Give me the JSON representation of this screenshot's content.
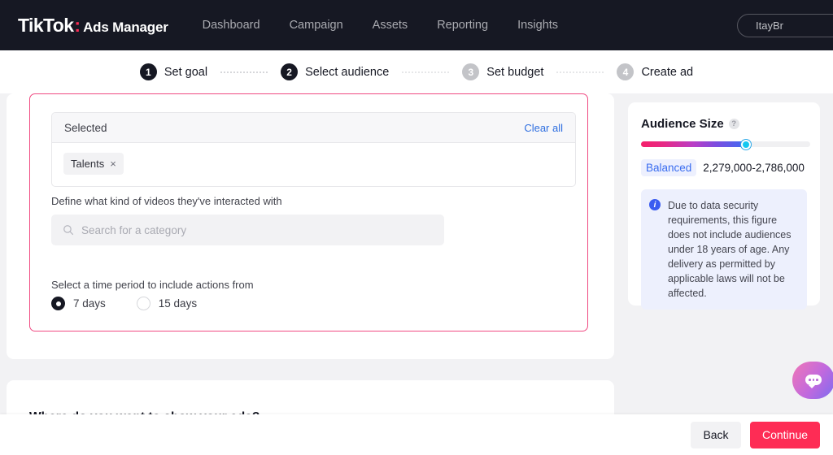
{
  "header": {
    "brand_primary": "TikTok",
    "brand_colon": ":",
    "brand_secondary": "Ads Manager",
    "nav_items": [
      {
        "label": "Dashboard"
      },
      {
        "label": "Campaign"
      },
      {
        "label": "Assets"
      },
      {
        "label": "Reporting"
      },
      {
        "label": "Insights"
      }
    ],
    "account_name": "ItayBr"
  },
  "steps": [
    {
      "number": "1",
      "label": "Set goal",
      "state": "active"
    },
    {
      "number": "2",
      "label": "Select audience",
      "state": "active"
    },
    {
      "number": "3",
      "label": "Set budget",
      "state": "inactive"
    },
    {
      "number": "4",
      "label": "Create ad",
      "state": "inactive"
    }
  ],
  "main": {
    "selected": {
      "title": "Selected",
      "clear_all_label": "Clear all",
      "tags": [
        {
          "label": "Talents",
          "remove_glyph": "×"
        }
      ]
    },
    "define_label": "Define what kind of videos they've interacted with",
    "search": {
      "placeholder": "Search for a category",
      "icon": "search-icon",
      "value": ""
    },
    "time_period_label": "Select a time period to include actions from",
    "time_period_options": [
      {
        "label": "7 days",
        "selected": true
      },
      {
        "label": "15 days",
        "selected": false
      }
    ],
    "next_card_title": "Where do you want to show your ads?"
  },
  "audience": {
    "title": "Audience Size",
    "help_glyph": "?",
    "gauge_percent": "62",
    "badge_label": "Balanced",
    "range": "2,279,000-2,786,000",
    "info_icon": "info-icon",
    "info_text": "Due to data security requirements, this figure does not include audiences under 18 years of age. Any delivery as permitted by applicable laws will not be affected."
  },
  "chat": {
    "icon": "chat-bubble-icon"
  },
  "footer": {
    "back_label": "Back",
    "continue_label": "Continue"
  },
  "colors": {
    "brand_pink": "#fe2c55",
    "nav_bg": "#161823",
    "link_blue": "#2f6fe0",
    "panel_outline_pink": "#f04a82",
    "info_bg": "#edf0fd",
    "info_blue": "#3a5cf0"
  }
}
